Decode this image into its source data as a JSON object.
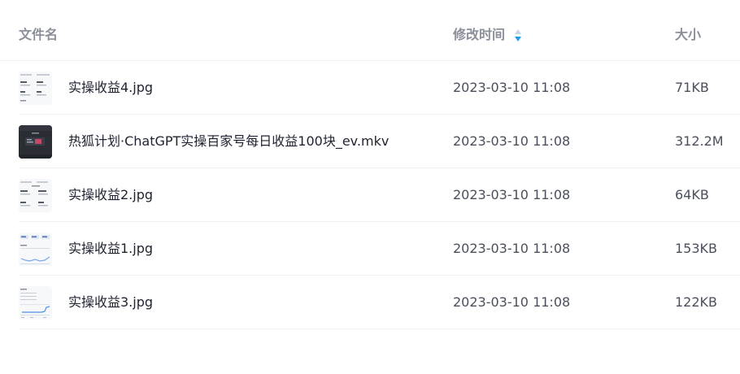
{
  "columns": {
    "name": "文件名",
    "modified": "修改时间",
    "size": "大小"
  },
  "sort": {
    "column": "modified",
    "icon": "sort-icon",
    "active_color": "#1e9bf0"
  },
  "files": [
    {
      "name": "实操收益4.jpg",
      "modified": "2023-03-10 11:08",
      "size": "71KB",
      "thumb": "image-thumbnail"
    },
    {
      "name": "热狐计划·ChatGPT实操百家号每日收益100块_ev.mkv",
      "modified": "2023-03-10 11:08",
      "size": "312.2M",
      "thumb": "video-thumbnail"
    },
    {
      "name": "实操收益2.jpg",
      "modified": "2023-03-10 11:08",
      "size": "64KB",
      "thumb": "image-thumbnail"
    },
    {
      "name": "实操收益1.jpg",
      "modified": "2023-03-10 11:08",
      "size": "153KB",
      "thumb": "image-thumbnail"
    },
    {
      "name": "实操收益3.jpg",
      "modified": "2023-03-10 11:08",
      "size": "122KB",
      "thumb": "image-thumbnail"
    }
  ]
}
